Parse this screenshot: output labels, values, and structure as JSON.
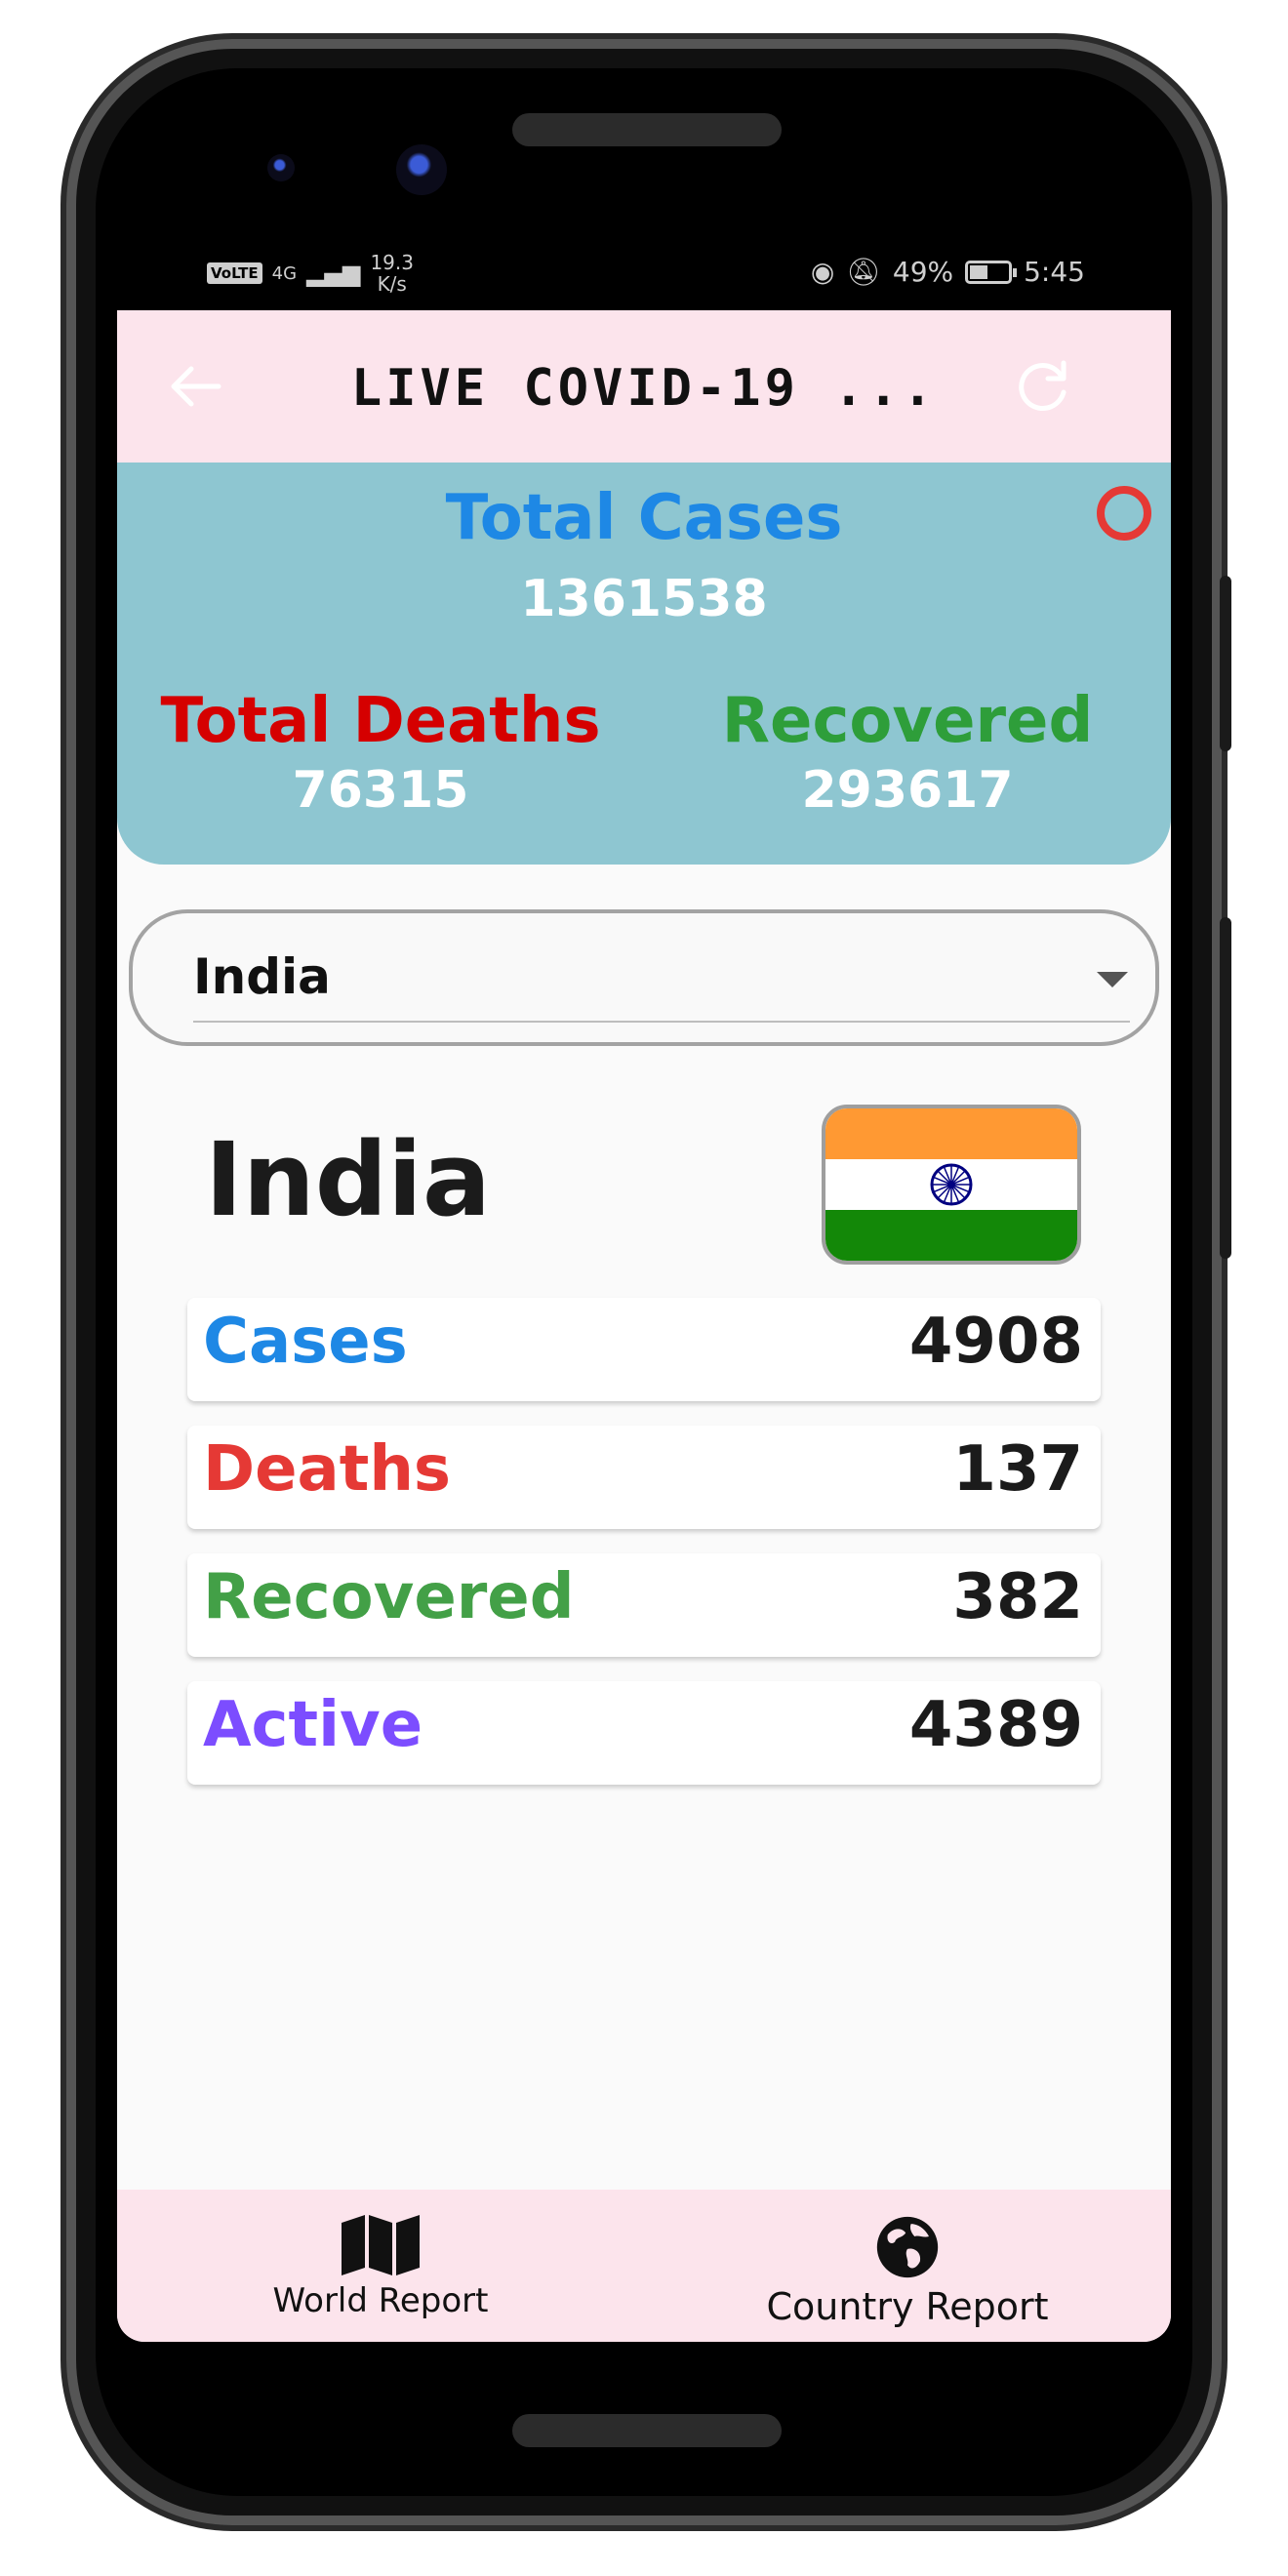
{
  "status_bar": {
    "network_tag": "VoLTE",
    "signal": "4G",
    "speed_value": "19.3",
    "speed_unit": "K/s",
    "battery": "49%",
    "time": "5:45"
  },
  "appbar": {
    "title": "LIVE COVID-19 ..."
  },
  "summary": {
    "total_cases_label": "Total Cases",
    "total_cases_value": "1361538",
    "total_deaths_label": "Total Deaths",
    "total_deaths_value": "76315",
    "recovered_label": "Recovered",
    "recovered_value": "293617"
  },
  "country_select": {
    "selected": "India"
  },
  "country": {
    "name": "India",
    "stats": [
      {
        "label": "Cases",
        "value": "4908",
        "color": "#1e88e5"
      },
      {
        "label": "Deaths",
        "value": "137",
        "color": "#e53935"
      },
      {
        "label": "Recovered",
        "value": "382",
        "color": "#43a047"
      },
      {
        "label": "Active",
        "value": "4389",
        "color": "#7c4dff"
      }
    ]
  },
  "bottom_nav": {
    "items": [
      {
        "label": "World Report",
        "icon": "map-icon"
      },
      {
        "label": "Country Report",
        "icon": "globe-icon"
      }
    ]
  }
}
